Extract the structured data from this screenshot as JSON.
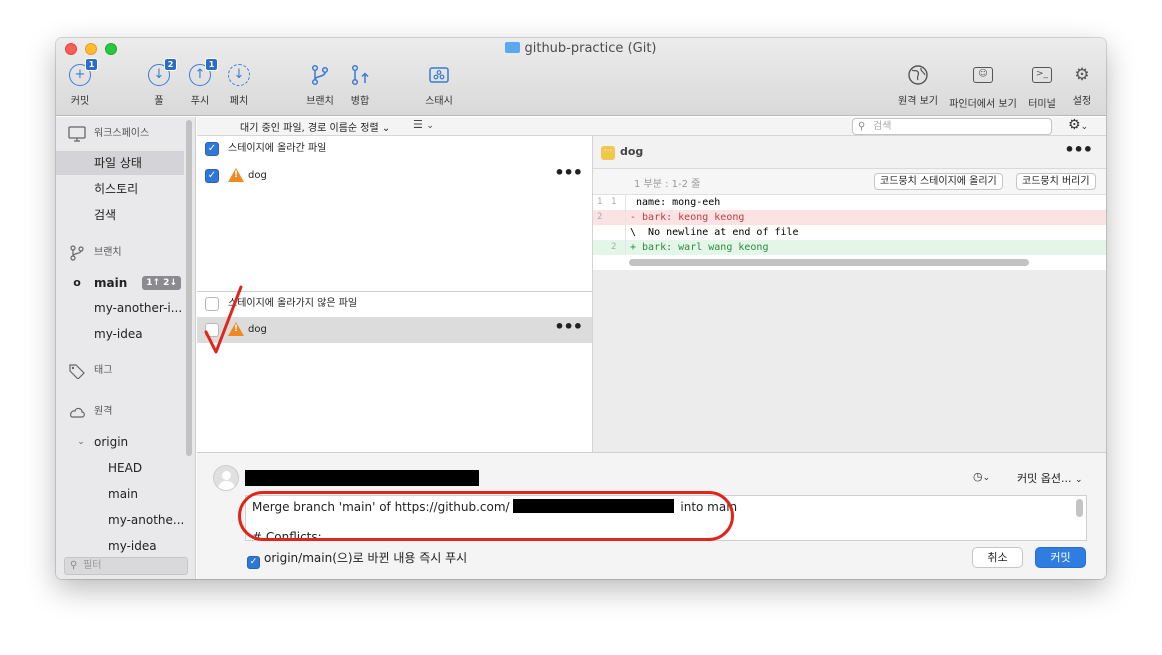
{
  "window": {
    "title": "github-practice (Git)"
  },
  "toolbar": {
    "commit": {
      "label": "커밋",
      "badge": "1"
    },
    "pull": {
      "label": "풀",
      "badge": "2"
    },
    "push": {
      "label": "푸시",
      "badge": "1"
    },
    "fetch": {
      "label": "페치"
    },
    "branch": {
      "label": "브랜치"
    },
    "merge": {
      "label": "병합"
    },
    "stash": {
      "label": "스태시"
    },
    "show_remote": {
      "label": "원격 보기"
    },
    "show_finder": {
      "label": "파인더에서 보기"
    },
    "terminal": {
      "label": "터미널"
    },
    "settings": {
      "label": "설정"
    }
  },
  "sidebar": {
    "workspace_header": "워크스페이스",
    "file_status": "파일 상태",
    "history": "히스토리",
    "search": "검색",
    "branches_header": "브랜치",
    "branches": [
      {
        "name": "main",
        "current": true,
        "ahead_behind": "1↑ 2↓"
      },
      {
        "name": "my-another-i..."
      },
      {
        "name": "my-idea"
      }
    ],
    "tags_header": "태그",
    "remotes_header": "원격",
    "remote": {
      "name": "origin",
      "branches": [
        "HEAD",
        "main",
        "my-anothe...",
        "my-idea"
      ]
    },
    "filter_placeholder": "필터"
  },
  "filterbar": {
    "sort_label": "대기 중인 파일, 경로 이름순 정렬",
    "search_placeholder": "검색"
  },
  "staged": {
    "header": "스테이지에 올라간 파일",
    "files": [
      {
        "name": "dog",
        "status": "conflict"
      }
    ]
  },
  "unstaged": {
    "header": "스테이지에 올라가지 않은 파일",
    "files": [
      {
        "name": "dog",
        "status": "conflict"
      }
    ]
  },
  "diff": {
    "file": "dog",
    "hunk_title": "1 부분 : 1-2 줄",
    "stage_hunk_label": "코드뭉치 스테이지에 올리기",
    "discard_hunk_label": "코드뭉치 버리기",
    "lines": [
      {
        "old": "1",
        "new": "1",
        "kind": "context",
        "text": " name: mong-eeh"
      },
      {
        "old": "2",
        "new": "",
        "kind": "del",
        "text": "- bark: keong keong"
      },
      {
        "old": "",
        "new": "",
        "kind": "note",
        "text": "\\  No newline at end of file"
      },
      {
        "old": "",
        "new": "2",
        "kind": "add",
        "text": "+ bark: warl wang keong"
      }
    ]
  },
  "commit": {
    "options_label": "커밋 옵션...",
    "message_prefix": "Merge branch 'main' of https://github.com/",
    "message_suffix": " into main",
    "message_line2": "# Conflicts:",
    "push_option_label": "origin/main(으)로 바뀐 내용 즉시 푸시",
    "cancel_label": "취소",
    "commit_label": "커밋"
  },
  "colors": {
    "accent": "#2f7de1",
    "annotation_red": "#e0251b",
    "conflict_orange": "#ef8a22"
  }
}
